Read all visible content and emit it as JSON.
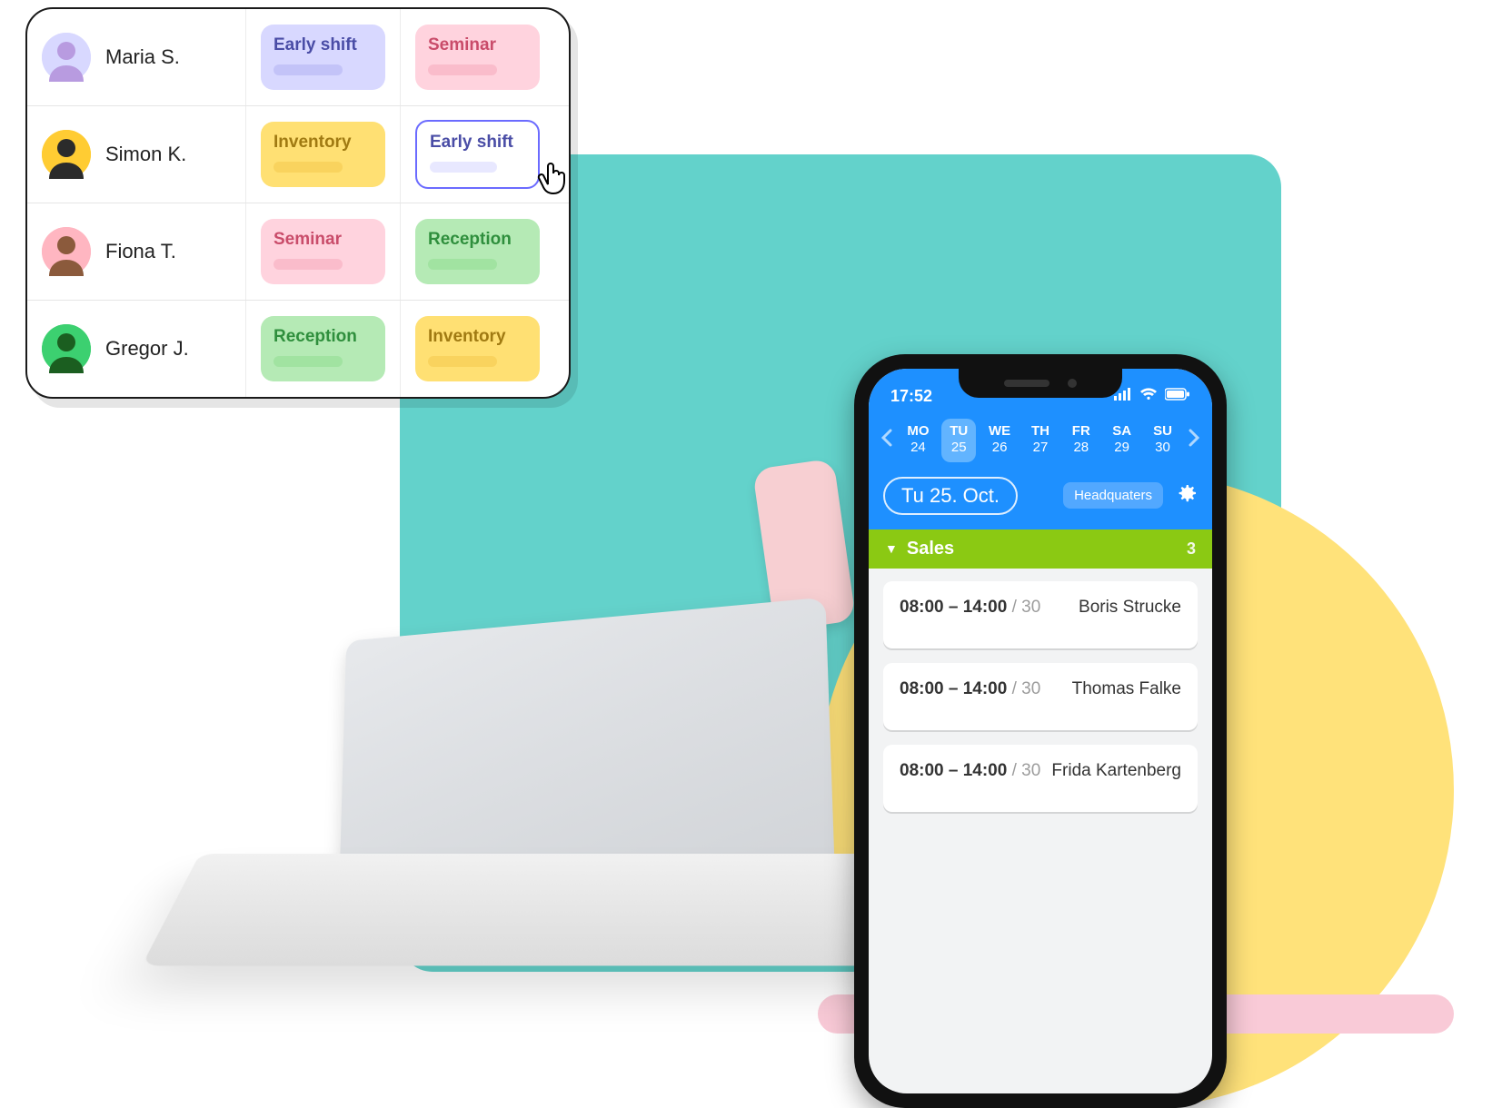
{
  "colors": {
    "teal": "#63d2cb",
    "yellow": "#ffe27a",
    "pink": "#f9cad7",
    "blue": "#1e90ff",
    "green_section": "#8bc913"
  },
  "schedule": {
    "rows": [
      {
        "name": "Maria S.",
        "avatar_color": "#d8d8ff",
        "shifts": [
          {
            "label": "Early shift",
            "color": "purple",
            "highlighted": false
          },
          {
            "label": "Seminar",
            "color": "pink",
            "highlighted": false
          }
        ]
      },
      {
        "name": "Simon K.",
        "avatar_color": "#ffcc33",
        "shifts": [
          {
            "label": "Inventory",
            "color": "yellow",
            "highlighted": false
          },
          {
            "label": "Early shift",
            "color": "outline",
            "highlighted": true
          }
        ]
      },
      {
        "name": "Fiona T.",
        "avatar_color": "#ffb6c1",
        "shifts": [
          {
            "label": "Seminar",
            "color": "pink",
            "highlighted": false
          },
          {
            "label": "Reception",
            "color": "green",
            "highlighted": false
          }
        ]
      },
      {
        "name": "Gregor J.",
        "avatar_color": "#3cd070",
        "shifts": [
          {
            "label": "Reception",
            "color": "green",
            "highlighted": false
          },
          {
            "label": "Inventory",
            "color": "yellow",
            "highlighted": false
          }
        ]
      }
    ],
    "cursor_icon": "cursor-pointer-icon"
  },
  "phone": {
    "status_time": "17:52",
    "status_icons": {
      "signal": "signal-icon",
      "wifi": "wifi-icon",
      "battery": "battery-icon"
    },
    "week": {
      "prev_icon": "chevron-left-icon",
      "next_icon": "chevron-right-icon",
      "days": [
        {
          "dow": "MO",
          "date": "24",
          "selected": false
        },
        {
          "dow": "TU",
          "date": "25",
          "selected": true
        },
        {
          "dow": "WE",
          "date": "26",
          "selected": false
        },
        {
          "dow": "TH",
          "date": "27",
          "selected": false
        },
        {
          "dow": "FR",
          "date": "28",
          "selected": false
        },
        {
          "dow": "SA",
          "date": "29",
          "selected": false
        },
        {
          "dow": "SU",
          "date": "30",
          "selected": false
        }
      ]
    },
    "date_label": "Tu 25. Oct.",
    "location_button": "Headquaters",
    "settings_icon": "gear-icon",
    "section": {
      "title": "Sales",
      "count": "3",
      "expand_icon": "triangle-down-icon"
    },
    "entries": [
      {
        "time": "08:00 – 14:00",
        "break": "/ 30",
        "name": "Boris Strucke"
      },
      {
        "time": "08:00 – 14:00",
        "break": "/ 30",
        "name": "Thomas Falke"
      },
      {
        "time": "08:00 – 14:00",
        "break": "/ 30",
        "name": "Frida Kartenberg"
      }
    ]
  }
}
